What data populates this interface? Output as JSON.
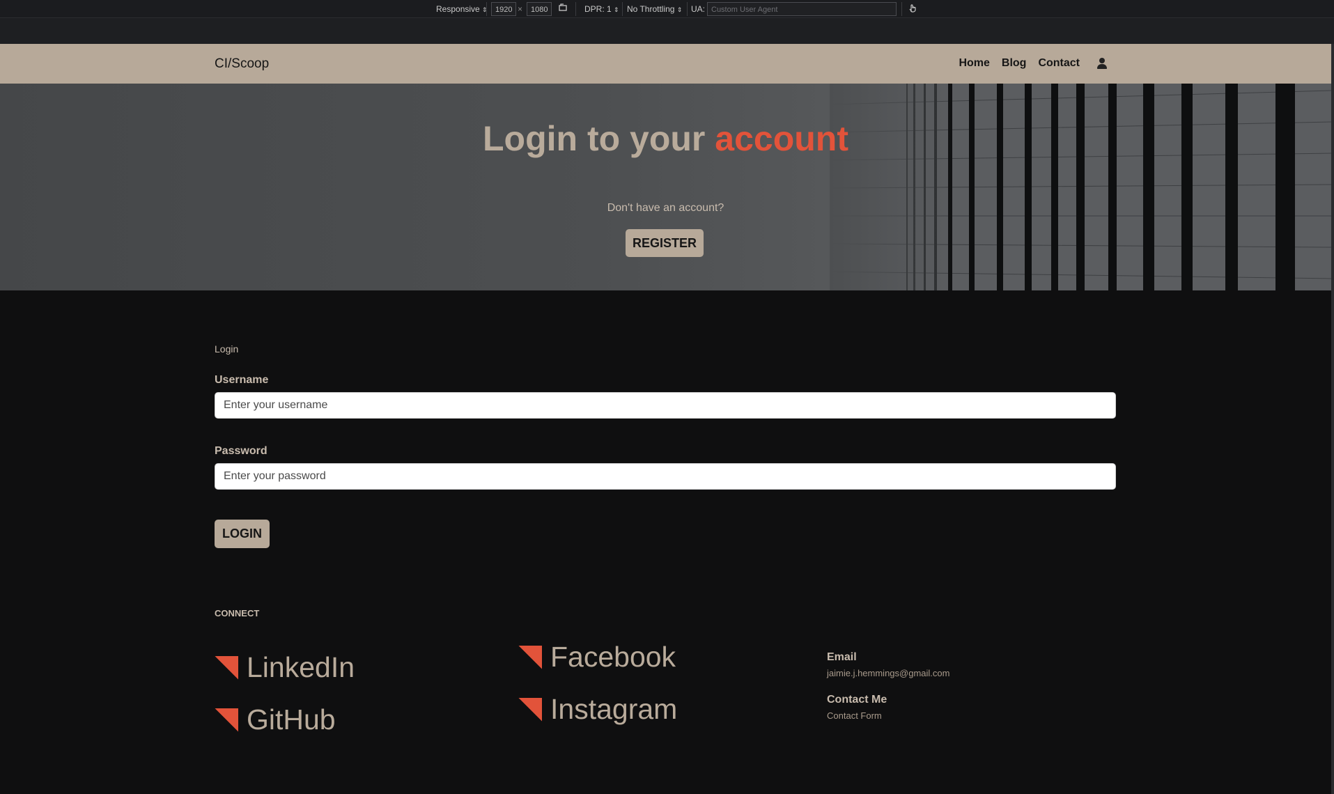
{
  "devtools": {
    "device_mode": "Responsive",
    "width": "1920",
    "height": "1080",
    "dims_separator": "×",
    "dpr": "DPR: 1",
    "throttling": "No Throttling",
    "ua_label": "UA:",
    "ua_placeholder": "Custom User Agent"
  },
  "navbar": {
    "brand": "CI/Scoop",
    "links": [
      "Home",
      "Blog",
      "Contact"
    ]
  },
  "hero": {
    "title_main": "Login to your ",
    "title_accent": "account",
    "subtitle": "Don't have an account?",
    "register_label": "REGISTER"
  },
  "login": {
    "heading": "Login",
    "username_label": "Username",
    "username_placeholder": "Enter your username",
    "password_label": "Password",
    "password_placeholder": "Enter your password",
    "submit_label": "LOGIN"
  },
  "connect": {
    "title": "CONNECT",
    "socials": [
      "LinkedIn",
      "GitHub",
      "Facebook",
      "Instagram"
    ],
    "email_label": "Email",
    "email_value": "jaimie.j.hemmings@gmail.com",
    "contact_label": "Contact Me",
    "contact_value": "Contact Form"
  },
  "colors": {
    "navbar_bg": "#b7a999",
    "accent": "#e2533a",
    "page_bg": "#0f0f10",
    "text_beige": "#c9bcae"
  }
}
